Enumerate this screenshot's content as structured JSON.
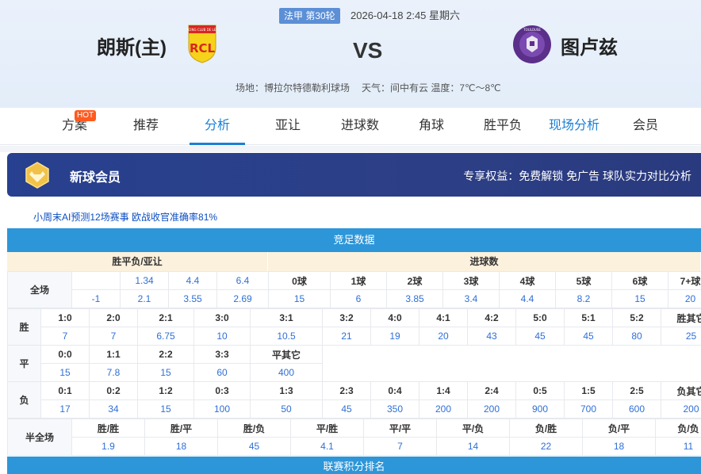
{
  "header": {
    "league_round": "法甲 第30轮",
    "match_time": "2026-04-18 2:45 星期六",
    "home_team": "朗斯(主)",
    "away_team": "图卢兹",
    "vs": "VS",
    "venue": "场地：博拉尔特德勒利球场",
    "weather": "天气：间中有云 温度：7℃～8℃",
    "home_logo_text": "RCL",
    "away_logo_text": "TOULOUSE FOOTBALL CLUB"
  },
  "tabs": [
    {
      "label": "方案",
      "badge": "HOT"
    },
    {
      "label": "推荐"
    },
    {
      "label": "分析"
    },
    {
      "label": "亚让"
    },
    {
      "label": "进球数"
    },
    {
      "label": "角球"
    },
    {
      "label": "胜平负"
    },
    {
      "label": "现场分析"
    },
    {
      "label": "会员"
    }
  ],
  "banner": {
    "title": "新球会员",
    "perks": "专享权益：免费解锁 免广告 球队实力对比分析"
  },
  "promo": "小周末AI预测12场赛事 欧战收官准确率81%",
  "jingcai": {
    "title": "竞足数据",
    "left_head": "胜平负/亚让",
    "right_head": "进球数",
    "row_label": "全场",
    "spf_row1": [
      "",
      "1.34",
      "4.4",
      "6.4"
    ],
    "spf_row2": [
      "-1",
      "2.1",
      "3.55",
      "2.69"
    ],
    "goals_heads": [
      "0球",
      "1球",
      "2球",
      "3球",
      "4球",
      "5球",
      "6球",
      "7+球"
    ],
    "goals_vals": [
      "15",
      "6",
      "3.85",
      "3.4",
      "4.4",
      "8.2",
      "15",
      "20"
    ]
  },
  "score": {
    "win_label": "胜",
    "draw_label": "平",
    "lose_label": "负",
    "win_heads": [
      "1:0",
      "2:0",
      "2:1",
      "3:0",
      "3:1",
      "3:2",
      "4:0",
      "4:1",
      "4:2",
      "5:0",
      "5:1",
      "5:2",
      "胜其它"
    ],
    "win_vals": [
      "7",
      "7",
      "6.75",
      "10",
      "10.5",
      "21",
      "19",
      "20",
      "43",
      "45",
      "45",
      "80",
      "25"
    ],
    "draw_heads": [
      "0:0",
      "1:1",
      "2:2",
      "3:3",
      "平其它"
    ],
    "draw_vals": [
      "15",
      "7.8",
      "15",
      "60",
      "400"
    ],
    "lose_heads": [
      "0:1",
      "0:2",
      "1:2",
      "0:3",
      "1:3",
      "2:3",
      "0:4",
      "1:4",
      "2:4",
      "0:5",
      "1:5",
      "2:5",
      "负其它"
    ],
    "lose_vals": [
      "17",
      "34",
      "15",
      "100",
      "50",
      "45",
      "350",
      "200",
      "200",
      "900",
      "700",
      "600",
      "200"
    ]
  },
  "htft": {
    "label": "半全场",
    "heads": [
      "胜/胜",
      "胜/平",
      "胜/负",
      "平/胜",
      "平/平",
      "平/负",
      "负/胜",
      "负/平",
      "负/负"
    ],
    "vals": [
      "1.9",
      "18",
      "45",
      "4.1",
      "7",
      "14",
      "22",
      "18",
      "11"
    ]
  },
  "league_table": {
    "title": "联赛积分排名"
  },
  "colors": {
    "accent": "#1a7fd6",
    "section_bar": "#2d96d9",
    "banner": "#2a3d86",
    "value": "#2f6fd6",
    "hot": "#ff5a1f"
  }
}
